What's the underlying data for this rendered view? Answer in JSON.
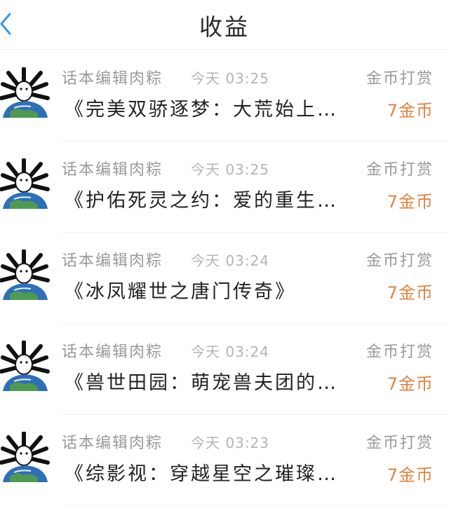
{
  "header": {
    "title": "收益",
    "back_icon": "chevron-left-icon",
    "accent_color": "#2f9bf0"
  },
  "records": [
    {
      "sender": "话本编辑肉粽",
      "time": "今天 03:25",
      "type": "金币打赏",
      "book": "《完美双骄逐梦：大荒始上…",
      "amount": "7金币"
    },
    {
      "sender": "话本编辑肉粽",
      "time": "今天 03:25",
      "type": "金币打赏",
      "book": "《护佑死灵之约：爱的重生…",
      "amount": "7金币"
    },
    {
      "sender": "话本编辑肉粽",
      "time": "今天 03:24",
      "type": "金币打赏",
      "book": "《冰凤耀世之唐门传奇》",
      "amount": "7金币"
    },
    {
      "sender": "话本编辑肉粽",
      "time": "今天 03:24",
      "type": "金币打赏",
      "book": "《兽世田园：萌宠兽夫团的…",
      "amount": "7金币"
    },
    {
      "sender": "话本编辑肉粽",
      "time": "今天 03:23",
      "type": "金币打赏",
      "book": "《综影视：穿越星空之璀璨…",
      "amount": "7金币"
    }
  ]
}
